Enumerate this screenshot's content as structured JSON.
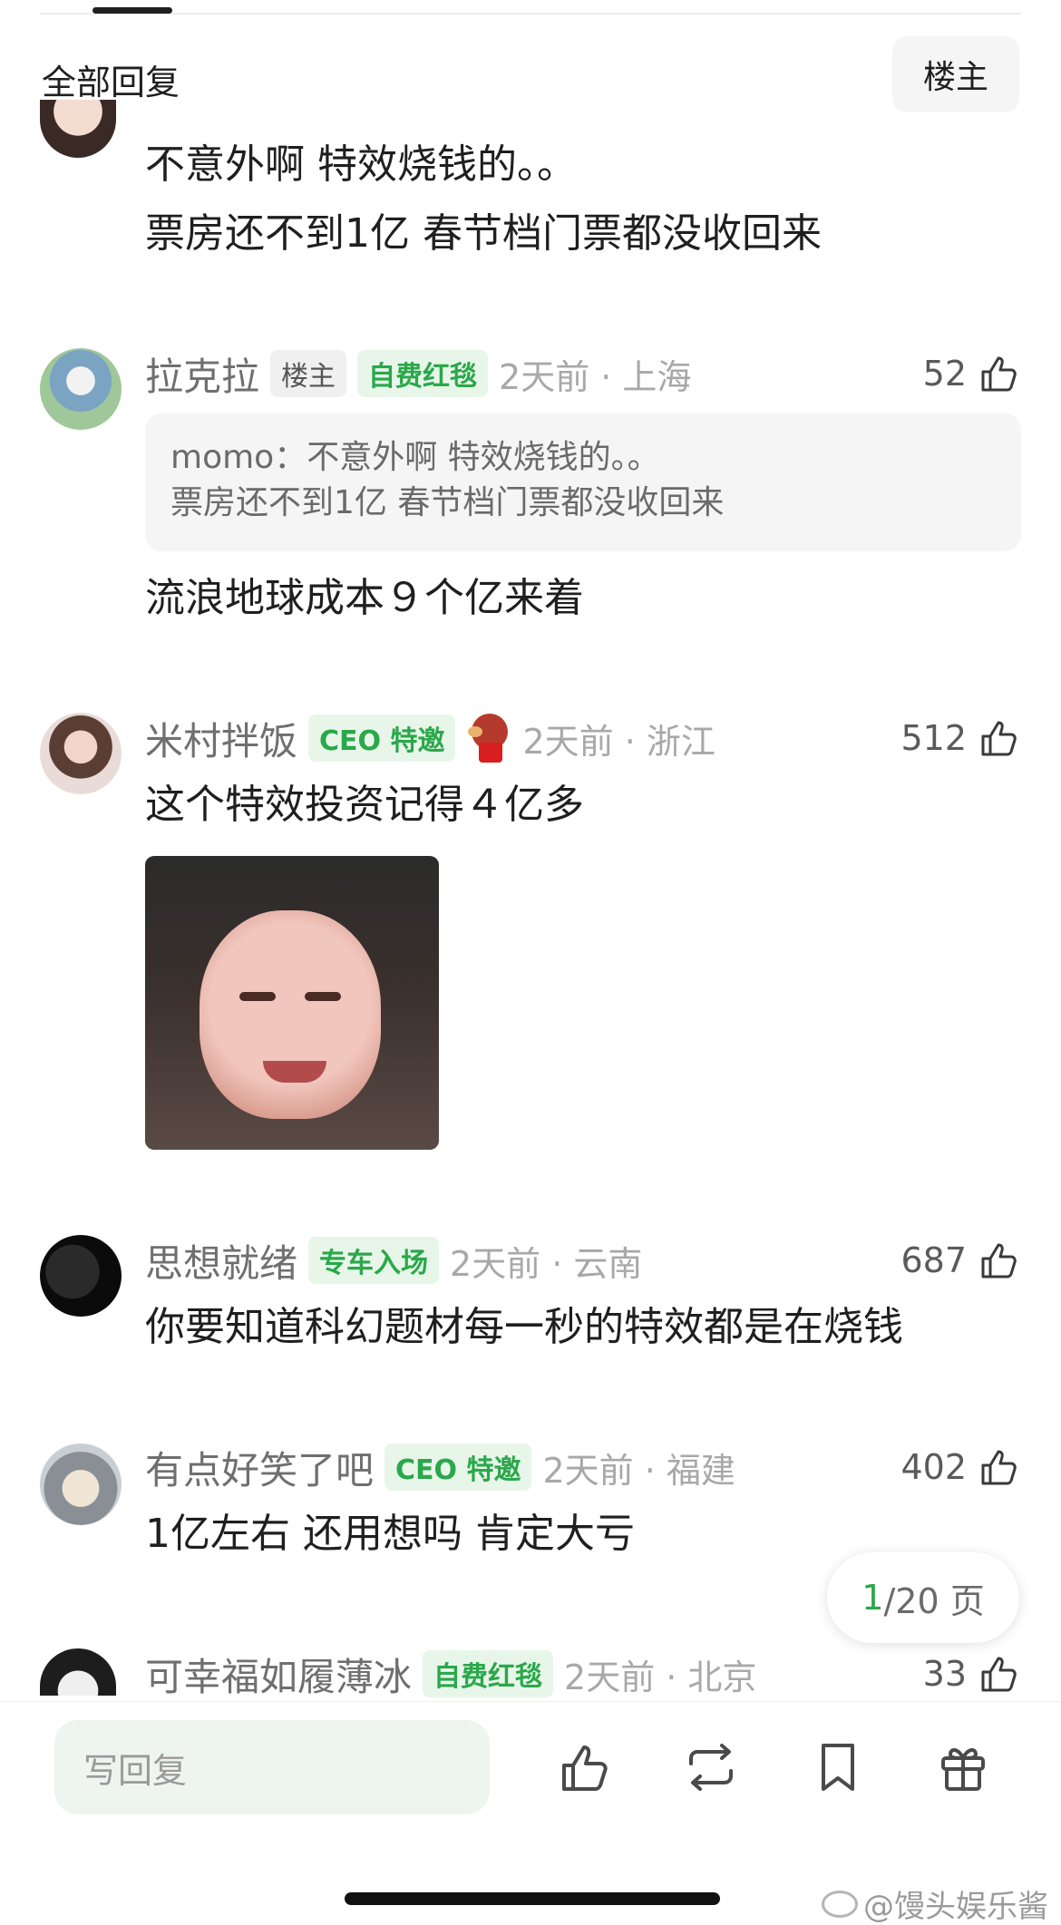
{
  "header": {
    "title": "全部回复",
    "owner_button": "楼主"
  },
  "comments": [
    {
      "username": "",
      "text_lines": [
        "不意外啊 特效烧钱的。。",
        "票房还不到1亿 春节档门票都没收回来"
      ]
    },
    {
      "username": "拉克拉",
      "tags": [
        "楼主",
        "自费红毯"
      ],
      "time": "2天前 · 上海",
      "likes": "52",
      "quote_lines": [
        "momo：不意外啊 特效烧钱的。。",
        "票房还不到1亿 春节档门票都没收回来"
      ],
      "text": "流浪地球成本９个亿来着"
    },
    {
      "username": "米村拌饭",
      "tags": [
        "CEO 特邀"
      ],
      "time": "2天前 · 浙江",
      "likes": "512",
      "text": "这个特效投资记得４亿多"
    },
    {
      "username": "思想就绪",
      "tags": [
        "专车入场"
      ],
      "time": "2天前 · 云南",
      "likes": "687",
      "text": "你要知道科幻题材每一秒的特效都是在烧钱"
    },
    {
      "username": "有点好笑了吧",
      "tags": [
        "CEO 特邀"
      ],
      "time": "2天前 · 福建",
      "likes": "402",
      "text": "1亿左右 还用想吗 肯定大亏"
    },
    {
      "username": "可幸福如履薄冰",
      "tags": [
        "自费红毯"
      ],
      "time": "2天前 · 北京",
      "likes": "33"
    }
  ],
  "pager": {
    "current": "1",
    "total": "/20 页"
  },
  "bottom_bar": {
    "reply_placeholder": "写回复"
  },
  "watermark": "@馒头娱乐酱",
  "colors": {
    "accent_green": "#2aa84a",
    "tag_green_bg": "#e8f6ea"
  }
}
